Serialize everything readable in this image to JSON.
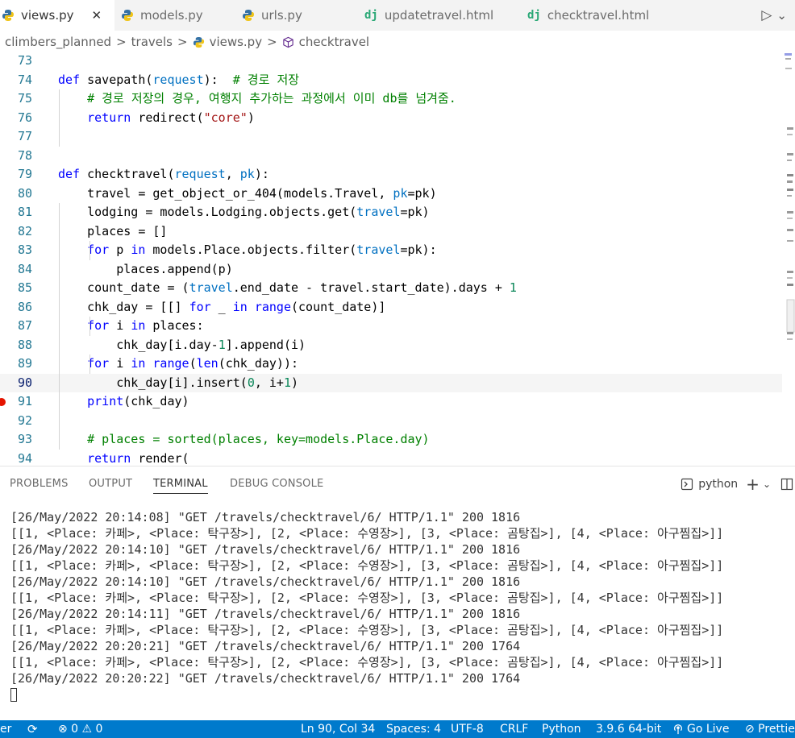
{
  "tabs": [
    {
      "label": "views.py",
      "icon": "python-icon",
      "active": true,
      "close": "✕"
    },
    {
      "label": "models.py",
      "icon": "python-icon"
    },
    {
      "label": "urls.py",
      "icon": "python-icon"
    },
    {
      "label": "updatetravel.html",
      "icon": "django-icon",
      "badge": "dj"
    },
    {
      "label": "checktravel.html",
      "icon": "django-icon",
      "badge": "dj"
    }
  ],
  "tab_actions": {
    "run": "▷",
    "more": "⌄"
  },
  "breadcrumb": [
    "climbers_planned",
    "travels",
    "views.py",
    "checktravel"
  ],
  "breadcrumb_sep": ">",
  "code_lines": [
    {
      "n": "73",
      "t": ""
    },
    {
      "n": "74",
      "t": "def savepath(request):  # 경로 저장"
    },
    {
      "n": "75",
      "t": "    # 경로 저장의 경우, 여행지 추가하는 과정에서 이미 db를 넘겨줌."
    },
    {
      "n": "76",
      "t": "    return redirect(\"core\")"
    },
    {
      "n": "77",
      "t": ""
    },
    {
      "n": "78",
      "t": ""
    },
    {
      "n": "79",
      "t": "def checktravel(request, pk):"
    },
    {
      "n": "80",
      "t": "    travel = get_object_or_404(models.Travel, pk=pk)"
    },
    {
      "n": "81",
      "t": "    lodging = models.Lodging.objects.get(travel=pk)"
    },
    {
      "n": "82",
      "t": "    places = []"
    },
    {
      "n": "83",
      "t": "    for p in models.Place.objects.filter(travel=pk):"
    },
    {
      "n": "84",
      "t": "        places.append(p)"
    },
    {
      "n": "85",
      "t": "    count_date = (travel.end_date - travel.start_date).days + 1"
    },
    {
      "n": "86",
      "t": "    chk_day = [[] for _ in range(count_date)]"
    },
    {
      "n": "87",
      "t": "    for i in places:"
    },
    {
      "n": "88",
      "t": "        chk_day[i.day-1].append(i)"
    },
    {
      "n": "89",
      "t": "    for i in range(len(chk_day)):"
    },
    {
      "n": "90",
      "t": "        chk_day[i].insert(0, i+1)"
    },
    {
      "n": "91",
      "t": "    print(chk_day)"
    },
    {
      "n": "92",
      "t": ""
    },
    {
      "n": "93",
      "t": "    # places = sorted(places, key=models.Place.day)"
    },
    {
      "n": "94",
      "t": "    return render("
    }
  ],
  "panel_tabs": [
    "PROBLEMS",
    "OUTPUT",
    "TERMINAL",
    "DEBUG CONSOLE"
  ],
  "panel_active": "TERMINAL",
  "terminal_shell": "python",
  "terminal_lines": [
    "[26/May/2022 20:14:08] \"GET /travels/checktravel/6/ HTTP/1.1\" 200 1816",
    "[[1, <Place: 카페>, <Place: 탁구장>], [2, <Place: 수영장>], [3, <Place: 곰탕집>], [4, <Place: 아구찜집>]]",
    "[26/May/2022 20:14:10] \"GET /travels/checktravel/6/ HTTP/1.1\" 200 1816",
    "[[1, <Place: 카페>, <Place: 탁구장>], [2, <Place: 수영장>], [3, <Place: 곰탕집>], [4, <Place: 아구찜집>]]",
    "[26/May/2022 20:14:10] \"GET /travels/checktravel/6/ HTTP/1.1\" 200 1816",
    "[[1, <Place: 카페>, <Place: 탁구장>], [2, <Place: 수영장>], [3, <Place: 곰탕집>], [4, <Place: 아구찜집>]]",
    "[26/May/2022 20:14:11] \"GET /travels/checktravel/6/ HTTP/1.1\" 200 1816",
    "[[1, <Place: 카페>, <Place: 탁구장>], [2, <Place: 수영장>], [3, <Place: 곰탕집>], [4, <Place: 아구찜집>]]",
    "[26/May/2022 20:20:21] \"GET /travels/checktravel/6/ HTTP/1.1\" 200 1764",
    "[[1, <Place: 카페>, <Place: 탁구장>], [2, <Place: 수영장>], [3, <Place: 곰탕집>], [4, <Place: 아구찜집>]]",
    "[26/May/2022 20:20:22] \"GET /travels/checktravel/6/ HTTP/1.1\" 200 1764"
  ],
  "status": {
    "left_label": "er",
    "sync": "⟳",
    "problems": "⊗ 0 ⚠ 0",
    "position": "Ln 90, Col 34",
    "spaces": "Spaces: 4",
    "encoding": "UTF-8",
    "eol": "CRLF",
    "language": "Python",
    "interpreter": "3.9.6 64-bit",
    "golive": "Go Live",
    "prettier": "⊘ Prettie"
  },
  "colors": {
    "statusbar": "#007acc",
    "keyword": "#0000ff",
    "string": "#a31515",
    "comment": "#008000",
    "param": "#0070c1",
    "breakpoint": "#e51400"
  }
}
